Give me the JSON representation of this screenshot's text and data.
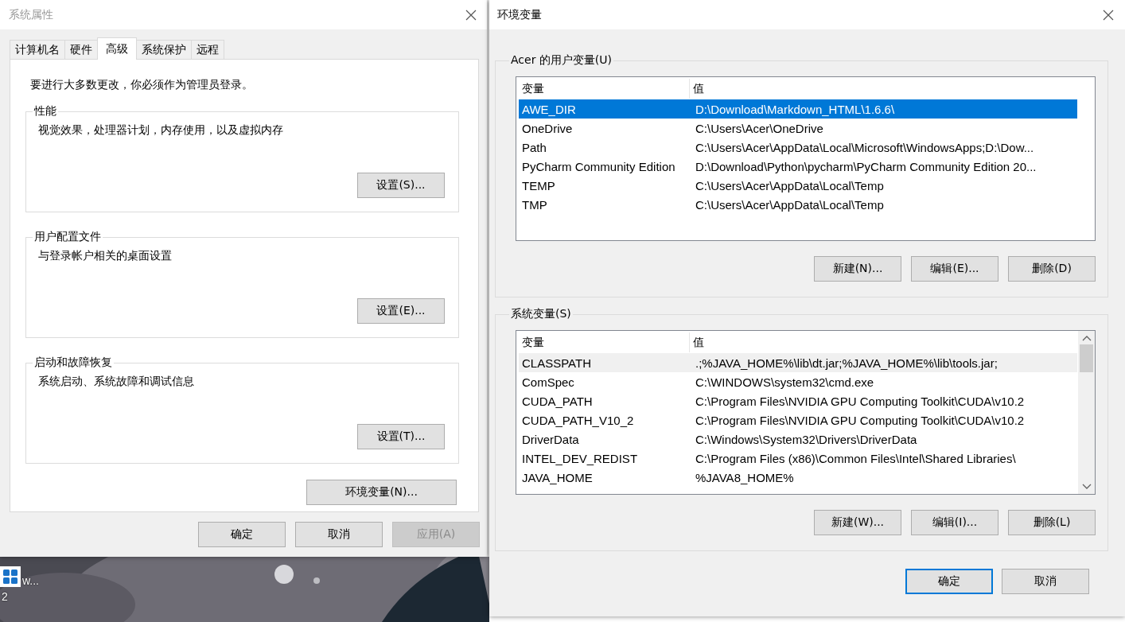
{
  "desktop": {
    "icon_labels": [
      "w...",
      "2"
    ]
  },
  "system_properties": {
    "title": "系统属性",
    "active": false,
    "tabs": [
      {
        "label": "计算机名",
        "selected": false
      },
      {
        "label": "硬件",
        "selected": false
      },
      {
        "label": "高级",
        "selected": true
      },
      {
        "label": "系统保护",
        "selected": false
      },
      {
        "label": "远程",
        "selected": false
      }
    ],
    "notice": "要进行大多数更改，你必须作为管理员登录。",
    "groups": [
      {
        "title": "性能",
        "description": "视觉效果，处理器计划，内存使用，以及虚拟内存",
        "button": "设置(S)..."
      },
      {
        "title": "用户配置文件",
        "description": "与登录帐户相关的桌面设置",
        "button": "设置(E)..."
      },
      {
        "title": "启动和故障恢复",
        "description": "系统启动、系统故障和调试信息",
        "button": "设置(T)..."
      }
    ],
    "env_button": "环境变量(N)...",
    "buttons": [
      {
        "label": "确定",
        "disabled": false
      },
      {
        "label": "取消",
        "disabled": false
      },
      {
        "label": "应用(A)",
        "disabled": true
      }
    ]
  },
  "environment_variables": {
    "title": "环境变量",
    "active": true,
    "user_variables": {
      "title": "Acer 的用户变量(U)",
      "columns": [
        "变量",
        "值"
      ],
      "rows": [
        {
          "name": "AWE_DIR",
          "value": "D:\\Download\\Markdown_HTML\\1.6.6\\",
          "selected": true,
          "hovered": false
        },
        {
          "name": "OneDrive",
          "value": "C:\\Users\\Acer\\OneDrive",
          "selected": false,
          "hovered": false
        },
        {
          "name": "Path",
          "value": "C:\\Users\\Acer\\AppData\\Local\\Microsoft\\WindowsApps;D:\\Dow...",
          "selected": false,
          "hovered": false
        },
        {
          "name": "PyCharm Community Edition",
          "value": "D:\\Download\\Python\\pycharm\\PyCharm Community Edition 20...",
          "selected": false,
          "hovered": false
        },
        {
          "name": "TEMP",
          "value": "C:\\Users\\Acer\\AppData\\Local\\Temp",
          "selected": false,
          "hovered": false
        },
        {
          "name": "TMP",
          "value": "C:\\Users\\Acer\\AppData\\Local\\Temp",
          "selected": false,
          "hovered": false
        }
      ],
      "buttons": [
        "新建(N)...",
        "编辑(E)...",
        "删除(D)"
      ]
    },
    "system_variables": {
      "title": "系统变量(S)",
      "columns": [
        "变量",
        "值"
      ],
      "rows": [
        {
          "name": "CLASSPATH",
          "value": ".;%JAVA_HOME%\\lib\\dt.jar;%JAVA_HOME%\\lib\\tools.jar;",
          "selected": false,
          "hovered": true
        },
        {
          "name": "ComSpec",
          "value": "C:\\WINDOWS\\system32\\cmd.exe",
          "selected": false,
          "hovered": false
        },
        {
          "name": "CUDA_PATH",
          "value": "C:\\Program Files\\NVIDIA GPU Computing Toolkit\\CUDA\\v10.2",
          "selected": false,
          "hovered": false
        },
        {
          "name": "CUDA_PATH_V10_2",
          "value": "C:\\Program Files\\NVIDIA GPU Computing Toolkit\\CUDA\\v10.2",
          "selected": false,
          "hovered": false
        },
        {
          "name": "DriverData",
          "value": "C:\\Windows\\System32\\Drivers\\DriverData",
          "selected": false,
          "hovered": false
        },
        {
          "name": "INTEL_DEV_REDIST",
          "value": "C:\\Program Files (x86)\\Common Files\\Intel\\Shared Libraries\\",
          "selected": false,
          "hovered": false
        },
        {
          "name": "JAVA_HOME",
          "value": "%JAVA8_HOME%",
          "selected": false,
          "hovered": false
        }
      ],
      "buttons": [
        "新建(W)...",
        "编辑(I)...",
        "删除(L)"
      ]
    },
    "buttons": [
      {
        "label": "确定",
        "default": true
      },
      {
        "label": "取消",
        "default": false
      }
    ]
  }
}
